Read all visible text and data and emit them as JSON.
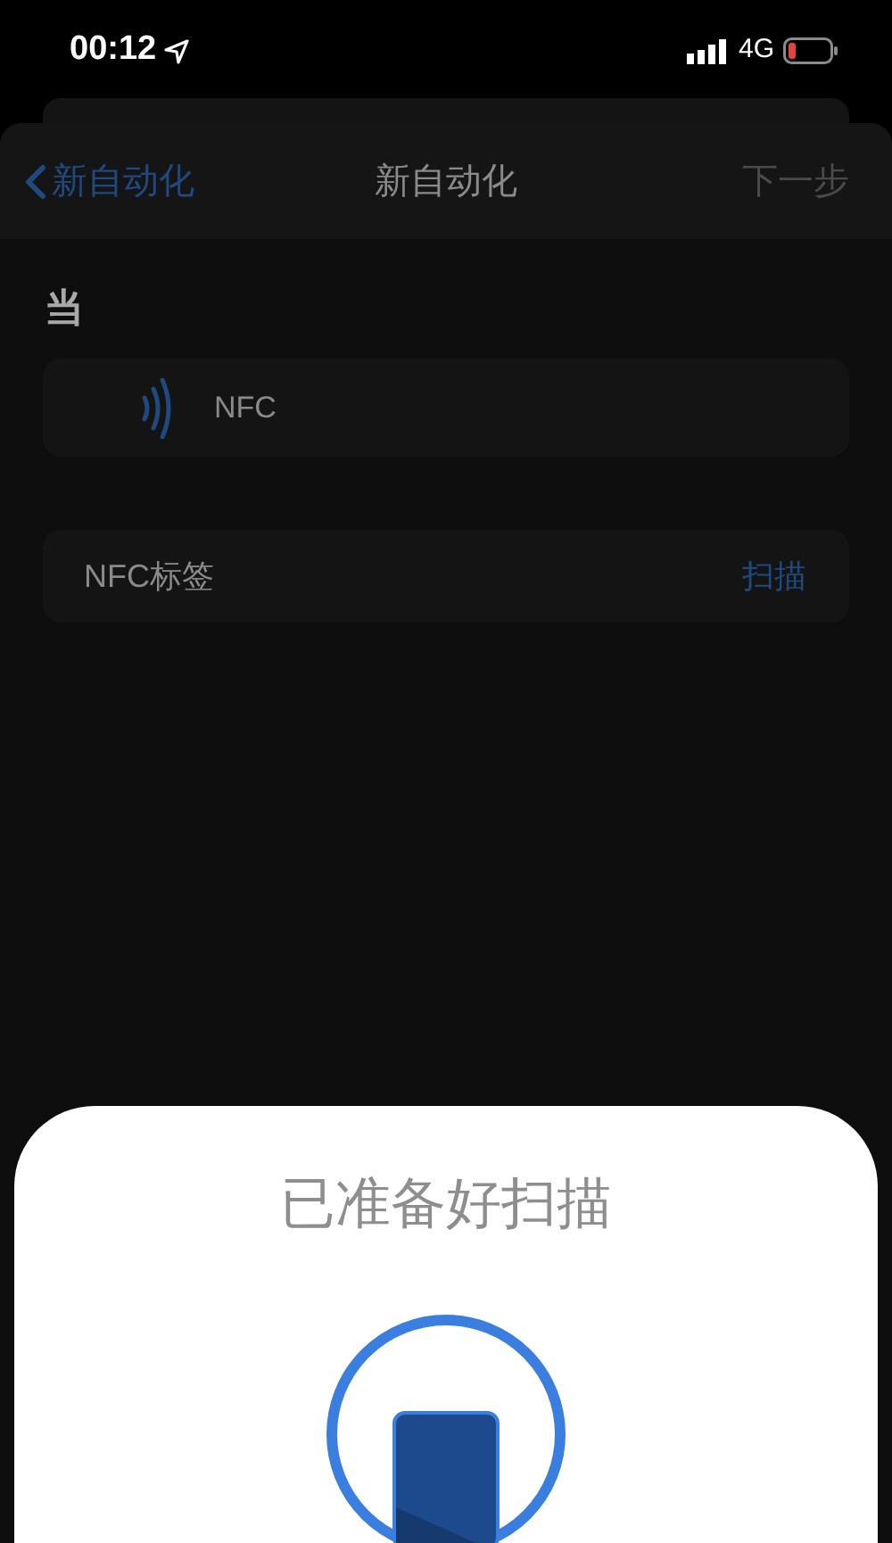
{
  "status_bar": {
    "time": "00:12",
    "network": "4G"
  },
  "nav_bar": {
    "back_label": "新自动化",
    "title": "新自动化",
    "next": {
      "label": "下一步",
      "disabled": true
    }
  },
  "section_title": "当",
  "trigger": {
    "label": "NFC"
  },
  "nfc_tag": {
    "label": "NFC标签",
    "action": "扫描"
  },
  "scan_sheet": {
    "title": "已准备好扫描"
  }
}
